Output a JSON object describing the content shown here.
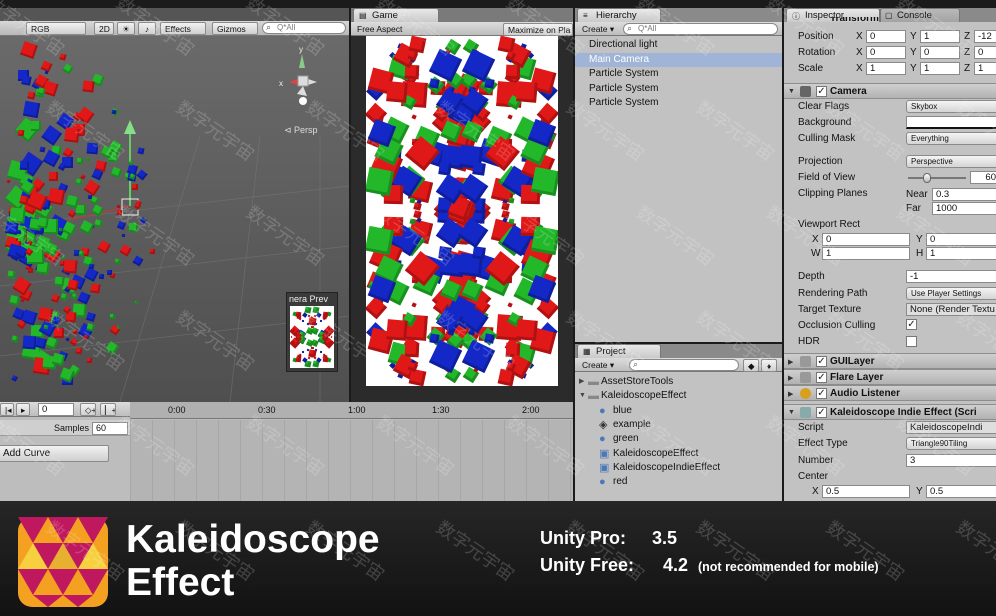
{
  "scene": {
    "toolbar": {
      "render_mode": "RGB",
      "mode_2d": "2D",
      "light_icon": "sun-icon",
      "audio_icon": "speaker-icon",
      "effects": "Effects",
      "gizmos": "Gizmos",
      "search_placeholder": "Q*All"
    },
    "persp": "⊲ Persp",
    "camera_preview": "nera Prev"
  },
  "game": {
    "tab": "Game",
    "aspect": "Free Aspect",
    "maximize": "Maximize on Pla"
  },
  "hierarchy": {
    "tab": "Hierarchy",
    "create": "Create ▾",
    "search_placeholder": "Q*All",
    "items": [
      "Directional light",
      "Main Camera",
      "Particle System",
      "Particle System",
      "Particle System"
    ],
    "selected_index": 1
  },
  "project": {
    "tab": "Project",
    "create": "Create ▾",
    "items": [
      {
        "label": "AssetStoreTools",
        "icon": "folder-icon",
        "indent": 0,
        "arrow": "▶"
      },
      {
        "label": "KaleidoscopeEffect",
        "icon": "folder-icon",
        "indent": 0,
        "arrow": "▼"
      },
      {
        "label": "blue",
        "icon": "material-icon",
        "indent": 1
      },
      {
        "label": "example",
        "icon": "unity-scene-icon",
        "indent": 1
      },
      {
        "label": "green",
        "icon": "material-icon",
        "indent": 1
      },
      {
        "label": "KaleidoscopeEffect",
        "icon": "script-icon",
        "indent": 1
      },
      {
        "label": "KaleidoscopeIndieEffect",
        "icon": "script-icon",
        "indent": 1
      },
      {
        "label": "red",
        "icon": "material-icon",
        "indent": 1
      }
    ]
  },
  "animation": {
    "samples_label": "Samples",
    "samples_value": "60",
    "add_curve": "Add Curve",
    "time_0": "0",
    "ticks": [
      "0:00",
      "0:30",
      "1:00",
      "1:30",
      "2:00"
    ]
  },
  "inspector": {
    "tab": "Inspector",
    "console_tab": "Console",
    "transform_title": "Transform",
    "transform": [
      {
        "label": "Position",
        "x": "0",
        "y": "1",
        "z": "-12"
      },
      {
        "label": "Rotation",
        "x": "0",
        "y": "0",
        "z": "0"
      },
      {
        "label": "Scale",
        "x": "1",
        "y": "1",
        "z": "1"
      }
    ],
    "axis_x": "X",
    "axis_y": "Y",
    "axis_z": "Z",
    "axis_w": "W",
    "axis_h": "H",
    "camera_title": "Camera",
    "camera": {
      "clear_flags_label": "Clear Flags",
      "clear_flags": "Skybox",
      "background_label": "Background",
      "background_color": "#ffffff",
      "culling_mask_label": "Culling Mask",
      "culling_mask": "Everything",
      "projection_label": "Projection",
      "projection": "Perspective",
      "fov_label": "Field of View",
      "fov": "60",
      "fov_fraction": 0.33,
      "clipping_label": "Clipping Planes",
      "near_label": "Near",
      "near": "0.3",
      "far_label": "Far",
      "far": "1000",
      "viewport_label": "Viewport Rect",
      "vp_x": "0",
      "vp_y": "0",
      "vp_w": "1",
      "vp_h": "1",
      "depth_label": "Depth",
      "depth": "-1",
      "rendering_path_label": "Rendering Path",
      "rendering_path": "Use Player Settings",
      "target_texture_label": "Target Texture",
      "target_texture": "None (Render Textu",
      "occlusion_label": "Occlusion Culling",
      "occlusion": "✓",
      "hdr_label": "HDR"
    },
    "components": [
      {
        "title": "GUILayer",
        "icon": "guilayer-icon"
      },
      {
        "title": "Flare Layer",
        "icon": "flare-layer-icon"
      },
      {
        "title": "Audio Listener",
        "icon": "audio-listener-icon"
      }
    ],
    "kaleido_title": "Kaleidoscope Indie Effect (Scri",
    "kaleido": {
      "script_label": "Script",
      "script": "KaleidoscopeIndi",
      "effect_type_label": "Effect Type",
      "effect_type": "Triangle90Tiling",
      "number_label": "Number",
      "number": "3",
      "center_label": "Center",
      "center_x": "0.5",
      "center_y": "0.5"
    }
  },
  "banner": {
    "logo_icon": "kaleidoscope-logo-icon",
    "title_line1": "Kaleidoscope",
    "title_line2": "Effect",
    "pro_label": "Unity Pro:",
    "pro_version": "3.5",
    "free_label": "Unity Free:",
    "free_version": "4.2",
    "free_note": "(not recommended for mobile)"
  },
  "watermark": "数字元宇宙",
  "colors": {
    "red": "#e01818",
    "green": "#22b82a",
    "blue": "#1428c8",
    "panel": "#c2c2c2",
    "selection": "#9fb4d6"
  }
}
